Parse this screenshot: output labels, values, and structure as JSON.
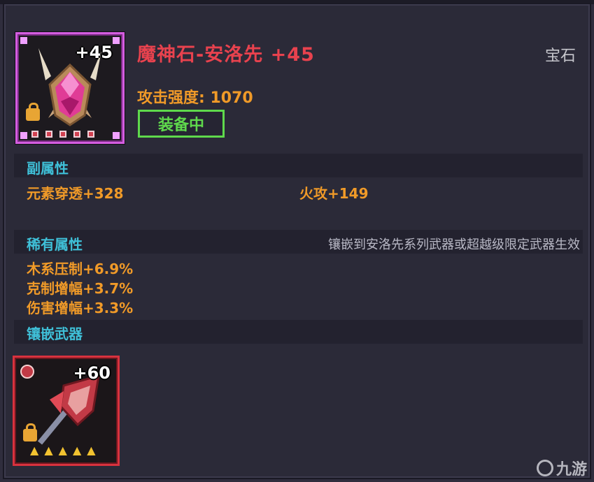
{
  "gem": {
    "level_badge": "+45",
    "title": "魔神石-安洛先 +45",
    "type_label": "宝石",
    "attack": "攻击强度: 1070",
    "equip_status": "装备中"
  },
  "secondary": {
    "title": "副属性",
    "stats": [
      "元素穿透+328",
      "火攻+149"
    ]
  },
  "rare": {
    "title": "稀有属性",
    "note": "镶嵌到安洛先系列武器或超越级限定武器生效",
    "stats": [
      "木系压制+6.9%",
      "克制增幅+3.7%",
      "伤害增幅+3.3%"
    ]
  },
  "inlaid": {
    "title": "镶嵌武器",
    "weapon_level": "+60"
  },
  "watermark": "九游",
  "colors": {
    "title_red": "#e8424e",
    "stat_orange": "#f09a28",
    "section_cyan": "#3fc0d8",
    "equip_green": "#5fd94c",
    "gem_frame": "#d45de0",
    "weapon_frame": "#d8323e"
  }
}
